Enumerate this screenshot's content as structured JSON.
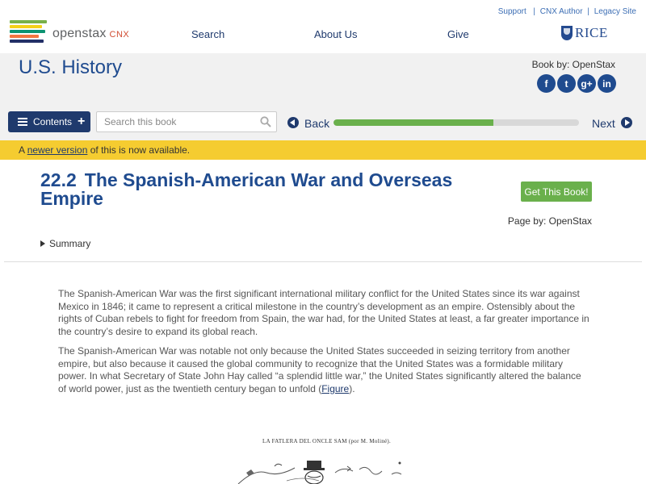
{
  "header": {
    "logo": {
      "brand": "openstax",
      "suffix": "CNX"
    },
    "utility_links": [
      "Support",
      "CNX Author",
      "Legacy Site"
    ],
    "nav": [
      "Search",
      "About Us",
      "Give"
    ],
    "partner": "RICE"
  },
  "book": {
    "title": "U.S. History",
    "by": "Book by: OpenStax",
    "socials": [
      {
        "name": "facebook-icon",
        "glyph": "f"
      },
      {
        "name": "twitter-icon",
        "glyph": "t"
      },
      {
        "name": "google-plus-icon",
        "glyph": "g+"
      },
      {
        "name": "linkedin-icon",
        "glyph": "in"
      }
    ]
  },
  "toolbar": {
    "contents_label": "Contents",
    "search_placeholder": "Search this book",
    "back_label": "Back",
    "next_label": "Next",
    "progress_fraction": 0.65
  },
  "notice": {
    "prefix": "A ",
    "link": "newer version",
    "suffix": " of this is now available."
  },
  "page": {
    "number": "22.2",
    "title": "The Spanish-American War and Overseas Empire",
    "get_book": "Get This Book!",
    "by": "Page by: OpenStax",
    "summary": "Summary"
  },
  "content": {
    "para1": "The Spanish-American War was the first significant international military conflict for the United States since its war against Mexico in 1846; it came to represent a critical milestone in the country’s development as an empire. Ostensibly about the rights of Cuban rebels to fight for freedom from Spain, the war had, for the United States at least, a far greater importance in the country’s desire to expand its global reach.",
    "para2_start": "The Spanish-American War was notable not only because the United States succeeded in seizing territory from another empire, but also because it caused the global community to recognize that the United States was a formidable military power. In what Secretary of State John Hay called “a splendid little war,” the United States significantly altered the balance of world power, just as the twentieth century began to unfold (",
    "para2_link": "Figure",
    "para2_end": ").",
    "figure_caption": "LA FATLERA DEL ONCLE SAM (por M. Moliné)."
  },
  "colors": {
    "navy": "#1f3a6d",
    "title_blue": "#1f4b8f",
    "green": "#6ab04c",
    "notice_yellow": "#f5cc30",
    "header_gray": "#f1f1f1"
  }
}
